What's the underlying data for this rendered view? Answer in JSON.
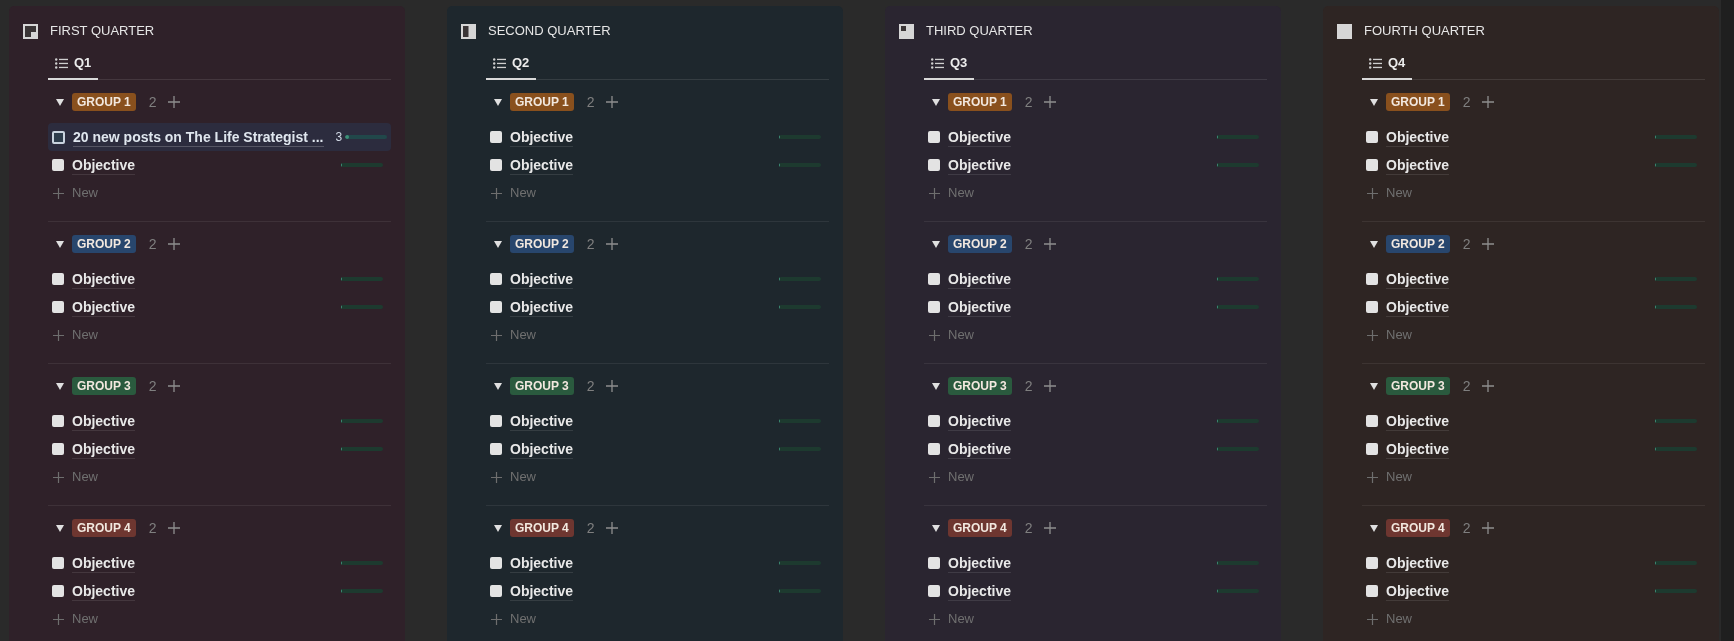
{
  "columns": [
    {
      "title": "FIRST QUARTER",
      "views": [
        {
          "label": "Q1",
          "selected": true
        }
      ],
      "groups": [
        {
          "label": "GROUP 1",
          "color": "#89501d",
          "count": "2",
          "expanded": true,
          "items": [
            {
              "title": "20 new posts on The Life Strategist ...",
              "checked": false,
              "hovered": true,
              "count": "3",
              "level": 0.1
            },
            {
              "title": "Objective",
              "checked": false,
              "hovered": false,
              "level": 0
            }
          ],
          "new_label": "New"
        },
        {
          "label": "GROUP 2",
          "color": "#28466d",
          "count": "2",
          "expanded": true,
          "items": [
            {
              "title": "Objective",
              "checked": false,
              "hovered": false,
              "level": 0
            },
            {
              "title": "Objective",
              "checked": false,
              "hovered": false,
              "level": 0
            }
          ],
          "new_label": "New"
        },
        {
          "label": "GROUP 3",
          "color": "#2a5a3e",
          "count": "2",
          "expanded": true,
          "items": [
            {
              "title": "Objective",
              "checked": false,
              "hovered": false,
              "level": 0
            },
            {
              "title": "Objective",
              "checked": false,
              "hovered": false,
              "level": 0
            }
          ],
          "new_label": "New"
        },
        {
          "label": "GROUP 4",
          "color": "#6e3630",
          "count": "2",
          "expanded": true,
          "items": [
            {
              "title": "Objective",
              "checked": false,
              "hovered": false,
              "level": 0
            },
            {
              "title": "Objective",
              "checked": false,
              "hovered": false,
              "level": 0
            }
          ],
          "new_label": "New"
        }
      ]
    },
    {
      "title": "SECOND QUARTER",
      "views": [
        {
          "label": "Q2",
          "selected": true
        }
      ],
      "groups": [
        {
          "label": "GROUP 1",
          "color": "#89501d",
          "count": "2",
          "expanded": true,
          "items": [
            {
              "title": "Objective",
              "checked": false,
              "hovered": false,
              "level": 0
            },
            {
              "title": "Objective",
              "checked": false,
              "hovered": false,
              "level": 0
            }
          ],
          "new_label": "New"
        },
        {
          "label": "GROUP 2",
          "color": "#28466d",
          "count": "2",
          "expanded": true,
          "items": [
            {
              "title": "Objective",
              "checked": false,
              "hovered": false,
              "level": 0
            },
            {
              "title": "Objective",
              "checked": false,
              "hovered": false,
              "level": 0
            }
          ],
          "new_label": "New"
        },
        {
          "label": "GROUP 3",
          "color": "#2a5a3e",
          "count": "2",
          "expanded": true,
          "items": [
            {
              "title": "Objective",
              "checked": false,
              "hovered": false,
              "level": 0
            },
            {
              "title": "Objective",
              "checked": false,
              "hovered": false,
              "level": 0
            }
          ],
          "new_label": "New"
        },
        {
          "label": "GROUP 4",
          "color": "#6e3630",
          "count": "2",
          "expanded": true,
          "items": [
            {
              "title": "Objective",
              "checked": false,
              "hovered": false,
              "level": 0
            },
            {
              "title": "Objective",
              "checked": false,
              "hovered": false,
              "level": 0
            }
          ],
          "new_label": "New"
        }
      ]
    },
    {
      "title": "THIRD QUARTER",
      "views": [
        {
          "label": "Q3",
          "selected": true
        }
      ],
      "groups": [
        {
          "label": "GROUP 1",
          "color": "#89501d",
          "count": "2",
          "expanded": true,
          "items": [
            {
              "title": "Objective",
              "checked": false,
              "hovered": false,
              "level": 0
            },
            {
              "title": "Objective",
              "checked": false,
              "hovered": false,
              "level": 0
            }
          ],
          "new_label": "New"
        },
        {
          "label": "GROUP 2",
          "color": "#28466d",
          "count": "2",
          "expanded": true,
          "items": [
            {
              "title": "Objective",
              "checked": false,
              "hovered": false,
              "level": 0
            },
            {
              "title": "Objective",
              "checked": false,
              "hovered": false,
              "level": 0
            }
          ],
          "new_label": "New"
        },
        {
          "label": "GROUP 3",
          "color": "#2a5a3e",
          "count": "2",
          "expanded": true,
          "items": [
            {
              "title": "Objective",
              "checked": false,
              "hovered": false,
              "level": 0
            },
            {
              "title": "Objective",
              "checked": false,
              "hovered": false,
              "level": 0
            }
          ],
          "new_label": "New"
        },
        {
          "label": "GROUP 4",
          "color": "#6e3630",
          "count": "2",
          "expanded": true,
          "items": [
            {
              "title": "Objective",
              "checked": false,
              "hovered": false,
              "level": 0
            },
            {
              "title": "Objective",
              "checked": false,
              "hovered": false,
              "level": 0
            }
          ],
          "new_label": "New"
        }
      ]
    },
    {
      "title": "FOURTH QUARTER",
      "views": [
        {
          "label": "Q4",
          "selected": true
        }
      ],
      "groups": [
        {
          "label": "GROUP 1",
          "color": "#89501d",
          "count": "2",
          "expanded": true,
          "items": [
            {
              "title": "Objective",
              "checked": false,
              "hovered": false,
              "level": 0
            },
            {
              "title": "Objective",
              "checked": false,
              "hovered": false,
              "level": 0
            }
          ],
          "new_label": "New"
        },
        {
          "label": "GROUP 2",
          "color": "#28466d",
          "count": "2",
          "expanded": true,
          "items": [
            {
              "title": "Objective",
              "checked": false,
              "hovered": false,
              "level": 0
            },
            {
              "title": "Objective",
              "checked": false,
              "hovered": false,
              "level": 0
            }
          ],
          "new_label": "New"
        },
        {
          "label": "GROUP 3",
          "color": "#2a5a3e",
          "count": "2",
          "expanded": true,
          "items": [
            {
              "title": "Objective",
              "checked": false,
              "hovered": false,
              "level": 0
            },
            {
              "title": "Objective",
              "checked": false,
              "hovered": false,
              "level": 0
            }
          ],
          "new_label": "New"
        },
        {
          "label": "GROUP 4",
          "color": "#6e3630",
          "count": "2",
          "expanded": true,
          "items": [
            {
              "title": "Objective",
              "checked": false,
              "hovered": false,
              "level": 0
            },
            {
              "title": "Objective",
              "checked": false,
              "hovered": false,
              "level": 0
            }
          ],
          "new_label": "New"
        }
      ]
    }
  ]
}
